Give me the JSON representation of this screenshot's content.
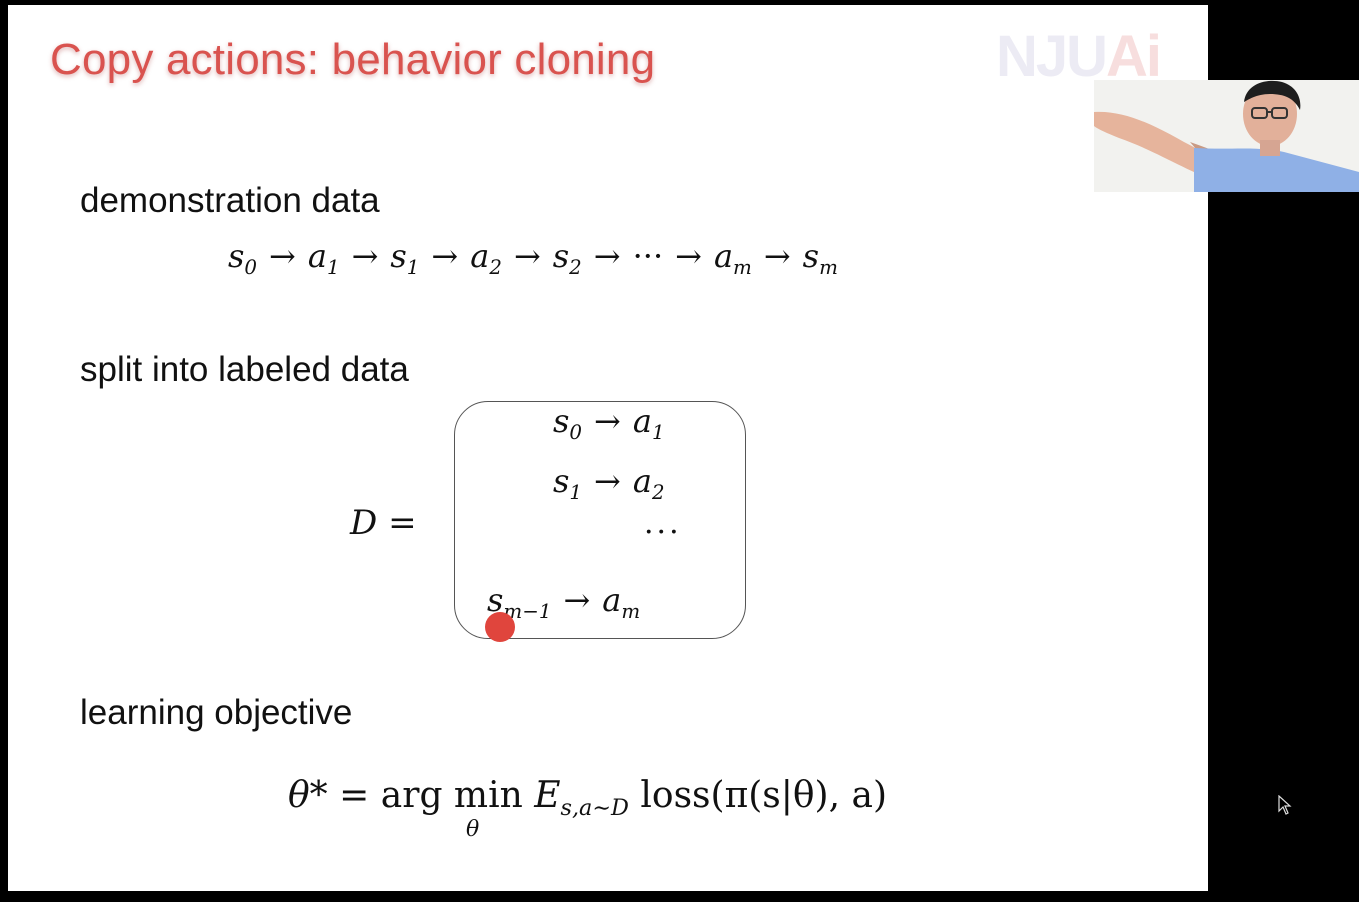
{
  "slide": {
    "title": "Copy actions: behavior cloning",
    "logo": {
      "main": "NJU",
      "accent": "Ai"
    }
  },
  "sections": {
    "demo_heading": "demonstration data",
    "split_heading": "split into labeled data",
    "objective_heading": "learning objective"
  },
  "demo_chain": [
    {
      "base": "s",
      "sub": "0"
    },
    {
      "base": "a",
      "sub": "1"
    },
    {
      "base": "s",
      "sub": "1"
    },
    {
      "base": "a",
      "sub": "2"
    },
    {
      "base": "s",
      "sub": "2"
    },
    {
      "base": "···",
      "sub": ""
    },
    {
      "base": "a",
      "sub": "m"
    },
    {
      "base": "s",
      "sub": "m"
    }
  ],
  "dataset": {
    "label": "D =",
    "pairs": [
      {
        "s": "s",
        "s_sub": "0",
        "a": "a",
        "a_sub": "1"
      },
      {
        "s": "s",
        "s_sub": "1",
        "a": "a",
        "a_sub": "2"
      },
      {
        "s": "s",
        "s_sub": "m−1",
        "a": "a",
        "a_sub": "m"
      }
    ],
    "ellipsis": "···"
  },
  "objective": {
    "lhs": "θ*",
    "eq": "=",
    "argmin": "arg min",
    "under": "θ",
    "E": "E",
    "E_sub": "s,a∼D",
    "loss": "loss(π(s|θ), a)"
  },
  "icons": {
    "arrow": "arrow-right-icon",
    "pointer": "laser-pointer-icon",
    "cursor": "mouse-cursor-icon"
  },
  "colors": {
    "title": "#d9534f",
    "pointer": "#e0453d",
    "background": "#000000"
  }
}
